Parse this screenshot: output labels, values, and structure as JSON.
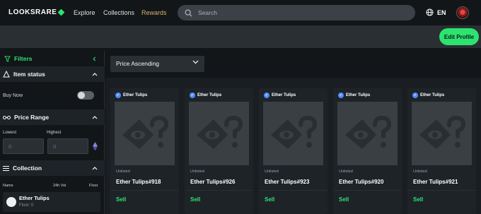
{
  "nav": {
    "logo": "LOOKSRARE",
    "links": [
      "Explore",
      "Collections",
      "Rewards"
    ],
    "search_placeholder": "Search",
    "language": "EN"
  },
  "profile": {
    "edit_label": "Edit Profile"
  },
  "sidebar": {
    "filters": "Filters",
    "item_status": "Item status",
    "buy_now": "Buy Now",
    "buy_now_enabled": false,
    "price_range": "Price Range",
    "lowest_label": "Lowest",
    "highest_label": "Highest",
    "lowest_placeholder": "0",
    "highest_placeholder": "0",
    "collection": "Collection",
    "col_name": "Name",
    "col_vol": "24h Vol",
    "col_floor": "Floor",
    "collection_item": {
      "name": "Ether Tulips",
      "floor": "Floor: 0"
    }
  },
  "sort": {
    "selected": "Price Ascending"
  },
  "cards": [
    {
      "collection": "Ether Tulips",
      "status": "Unlisted",
      "name": "Ether Tulips#918",
      "action": "Sell"
    },
    {
      "collection": "Ether Tulips",
      "status": "Unlisted",
      "name": "Ether Tulips#926",
      "action": "Sell"
    },
    {
      "collection": "Ether Tulips",
      "status": "Unlisted",
      "name": "Ether Tulips#923",
      "action": "Sell"
    },
    {
      "collection": "Ether Tulips",
      "status": "Unlisted",
      "name": "Ether Tulips#920",
      "action": "Sell"
    },
    {
      "collection": "Ether Tulips",
      "status": "Unlisted",
      "name": "Ether Tulips#921",
      "action": "Sell"
    }
  ],
  "colors": {
    "accent": "#2de370",
    "rewards": "#d4b06a",
    "verified": "#4f8dff"
  }
}
